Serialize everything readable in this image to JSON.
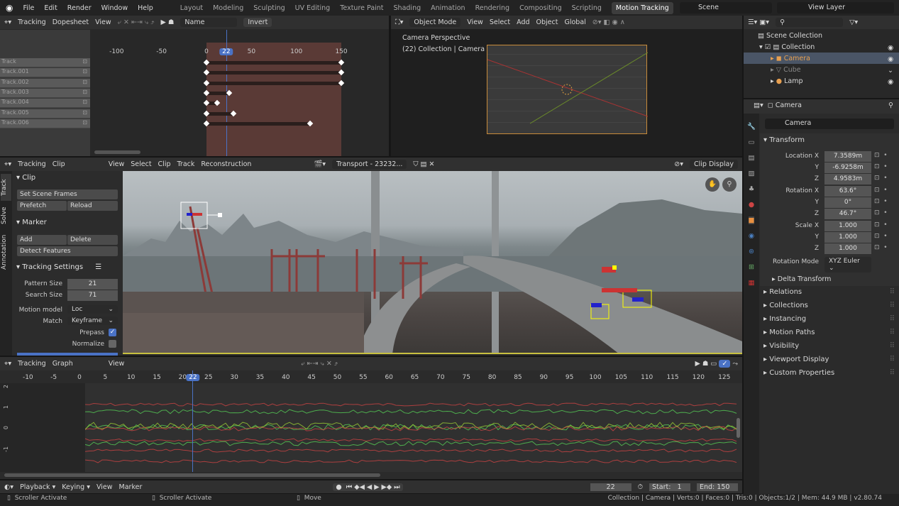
{
  "topbar": {
    "menus": [
      "File",
      "Edit",
      "Render",
      "Window",
      "Help"
    ],
    "workspaces": [
      "Layout",
      "Modeling",
      "Sculpting",
      "UV Editing",
      "Texture Paint",
      "Shading",
      "Animation",
      "Rendering",
      "Compositing",
      "Scripting",
      "Motion Tracking"
    ],
    "active_workspace": "Motion Tracking",
    "add": "+",
    "scene": "Scene",
    "view_layer": "View Layer"
  },
  "dopesheet": {
    "mode": "Tracking",
    "view_type": "Dopesheet",
    "view": "View",
    "sort": "Name",
    "invert": "Invert",
    "ruler": [
      "-100",
      "-50",
      "0",
      "22",
      "50",
      "100",
      "150"
    ],
    "tracks": [
      "Track",
      "Track.001",
      "Track.002",
      "Track.003",
      "Track.004",
      "Track.005",
      "Track.006"
    ],
    "track_ranges": [
      [
        0,
        150
      ],
      [
        0,
        150
      ],
      [
        0,
        150
      ],
      [
        0,
        25
      ],
      [
        0,
        12
      ],
      [
        0,
        30
      ],
      [
        0,
        115
      ]
    ]
  },
  "viewport": {
    "mode": "Object Mode",
    "menus": [
      "View",
      "Select",
      "Add",
      "Object"
    ],
    "orientation": "Global",
    "title": "Camera Perspective",
    "subtitle": "(22) Collection | Camera"
  },
  "outliner": {
    "root": "Scene Collection",
    "items": [
      {
        "name": "Collection"
      },
      {
        "name": "Camera"
      },
      {
        "name": "Cube"
      },
      {
        "name": "Lamp"
      }
    ]
  },
  "properties": {
    "object": "Camera",
    "name_field": "Camera",
    "transform": "Transform",
    "location": {
      "label": "Location X",
      "x": "7.3589m",
      "y": "-6.9258m",
      "z": "4.9583m"
    },
    "rotation": {
      "label": "Rotation X",
      "x": "63.6°",
      "y": "0°",
      "z": "46.7°"
    },
    "scale": {
      "label": "Scale X",
      "x": "1.000",
      "y": "1.000",
      "z": "1.000"
    },
    "axis_y": "Y",
    "axis_z": "Z",
    "rotation_mode_label": "Rotation Mode",
    "rotation_mode": "XYZ Euler",
    "delta": "Delta Transform",
    "sections": [
      "Relations",
      "Collections",
      "Instancing",
      "Motion Paths",
      "Visibility",
      "Viewport Display",
      "Custom Properties"
    ]
  },
  "clip": {
    "mode": "Tracking",
    "view_type": "Clip",
    "menus": [
      "View",
      "Select",
      "Clip",
      "Track",
      "Reconstruction"
    ],
    "clip_name": "Transport - 23232...",
    "display": "Clip Display",
    "tabs": [
      "Track",
      "Solve",
      "Annotation"
    ],
    "panel": {
      "clip": "Clip",
      "set_scene_frames": "Set Scene Frames",
      "prefetch": "Prefetch",
      "reload": "Reload",
      "marker": "Marker",
      "add": "Add",
      "delete": "Delete",
      "detect": "Detect Features",
      "tracking_settings": "Tracking Settings",
      "pattern_size_label": "Pattern Size",
      "pattern_size": "21",
      "search_size_label": "Search Size",
      "search_size": "71",
      "motion_model_label": "Motion model",
      "motion_model": "Loc",
      "match_label": "Match",
      "match": "Keyframe",
      "prepass": "Prepass",
      "prepass_checked": true,
      "normalize": "Normalize",
      "normalize_checked": false
    }
  },
  "graph": {
    "mode": "Tracking",
    "view_type": "Graph",
    "view": "View",
    "ruler": [
      "-10",
      "-5",
      "0",
      "5",
      "10",
      "15",
      "20",
      "22",
      "25",
      "30",
      "35",
      "40",
      "45",
      "50",
      "55",
      "60",
      "65",
      "70",
      "75",
      "80",
      "85",
      "90",
      "95",
      "100",
      "105",
      "110",
      "115",
      "120",
      "125"
    ],
    "y_ticks": [
      "2",
      "1",
      "0",
      "-1"
    ]
  },
  "timeline": {
    "menus": [
      "Playback",
      "Keying",
      "View",
      "Marker"
    ],
    "current_frame": "22",
    "start_label": "Start:",
    "start": "1",
    "end_label": "End:",
    "end": "150"
  },
  "statusbar": {
    "left": [
      "Scroller Activate",
      "Scroller Activate",
      "Move"
    ],
    "right": "Collection | Camera | Verts:0 | Faces:0 | Tris:0 | Objects:1/2 | Mem: 44.9 MB | v2.80.74"
  },
  "colors": {
    "accent": "#4a72c5",
    "selected": "#f39c3a",
    "bg": "#303030"
  }
}
